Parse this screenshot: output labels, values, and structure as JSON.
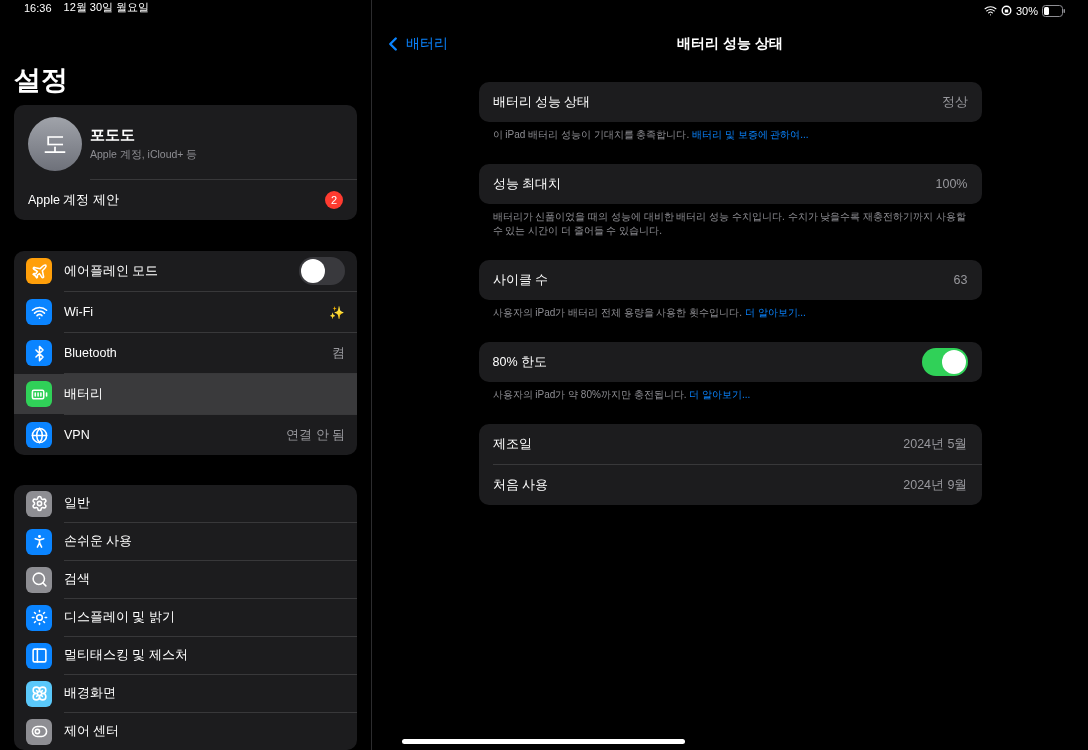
{
  "status_bar": {
    "time": "16:36",
    "date": "12월 30일 월요일",
    "battery_percent": "30%"
  },
  "sidebar": {
    "title": "설정",
    "profile": {
      "initial": "도",
      "name": "포도도",
      "subtitle": "Apple 계정, iCloud+ 등"
    },
    "account_suggestion": {
      "label": "Apple 계정 제안",
      "badge": "2"
    },
    "groups": [
      [
        {
          "label": "에어플레인 모드",
          "kind": "toggle",
          "on": false,
          "color": "#ff9f0a",
          "selected": false
        },
        {
          "label": "Wi-Fi",
          "kind": "value",
          "value": "✨",
          "color": "#0a84ff",
          "selected": false
        },
        {
          "label": "Bluetooth",
          "kind": "value",
          "value": "켬",
          "color": "#0a84ff",
          "selected": false
        },
        {
          "label": "배터리",
          "kind": "plain",
          "color": "#30d158",
          "selected": true
        },
        {
          "label": "VPN",
          "kind": "value",
          "value": "연결 안 됨",
          "color": "#0a84ff",
          "selected": false
        }
      ],
      [
        {
          "label": "일반",
          "kind": "plain",
          "color": "#8e8e93",
          "selected": false
        },
        {
          "label": "손쉬운 사용",
          "kind": "plain",
          "color": "#0a84ff",
          "selected": false
        },
        {
          "label": "검색",
          "kind": "plain",
          "color": "#8e8e93",
          "selected": false
        },
        {
          "label": "디스플레이 및 밝기",
          "kind": "plain",
          "color": "#0a84ff",
          "selected": false
        },
        {
          "label": "멀티태스킹 및 제스처",
          "kind": "plain",
          "color": "#0a84ff",
          "selected": false
        },
        {
          "label": "배경화면",
          "kind": "plain",
          "color": "#5ac8fa",
          "selected": false
        },
        {
          "label": "제어 센터",
          "kind": "plain",
          "color": "#8e8e93",
          "selected": false
        }
      ]
    ]
  },
  "detail": {
    "back_label": "배터리",
    "title": "배터리 성능 상태",
    "sections": [
      {
        "rows": [
          {
            "label": "배터리 성능 상태",
            "kind": "value",
            "value": "정상"
          }
        ],
        "footer": {
          "text": "이 iPad 배터리 성능이 기대치를 충족합니다.",
          "link": "배터리 및 보증에 관하여..."
        }
      },
      {
        "rows": [
          {
            "label": "성능 최대치",
            "kind": "value",
            "value": "100%"
          }
        ],
        "footer": {
          "text": "배터리가 신품이었을 때의 성능에 대비한 배터리 성능 수치입니다. 수치가 낮을수록 재충전하기까지 사용할 수 있는 시간이 더 줄어들 수 있습니다."
        }
      },
      {
        "rows": [
          {
            "label": "사이클 수",
            "kind": "value",
            "value": "63"
          }
        ],
        "footer": {
          "text": "사용자의 iPad가 배터리 전체 용량을 사용한 횟수입니다.",
          "link": "더 알아보기..."
        }
      },
      {
        "rows": [
          {
            "label": "80% 한도",
            "kind": "toggle",
            "on": true
          }
        ],
        "footer": {
          "text": "사용자의 iPad가 약 80%까지만 충전됩니다.",
          "link": "더 알아보기..."
        }
      },
      {
        "rows": [
          {
            "label": "제조일",
            "kind": "value",
            "value": "2024년 5월"
          },
          {
            "label": "처음 사용",
            "kind": "value",
            "value": "2024년 9월"
          }
        ]
      }
    ]
  }
}
